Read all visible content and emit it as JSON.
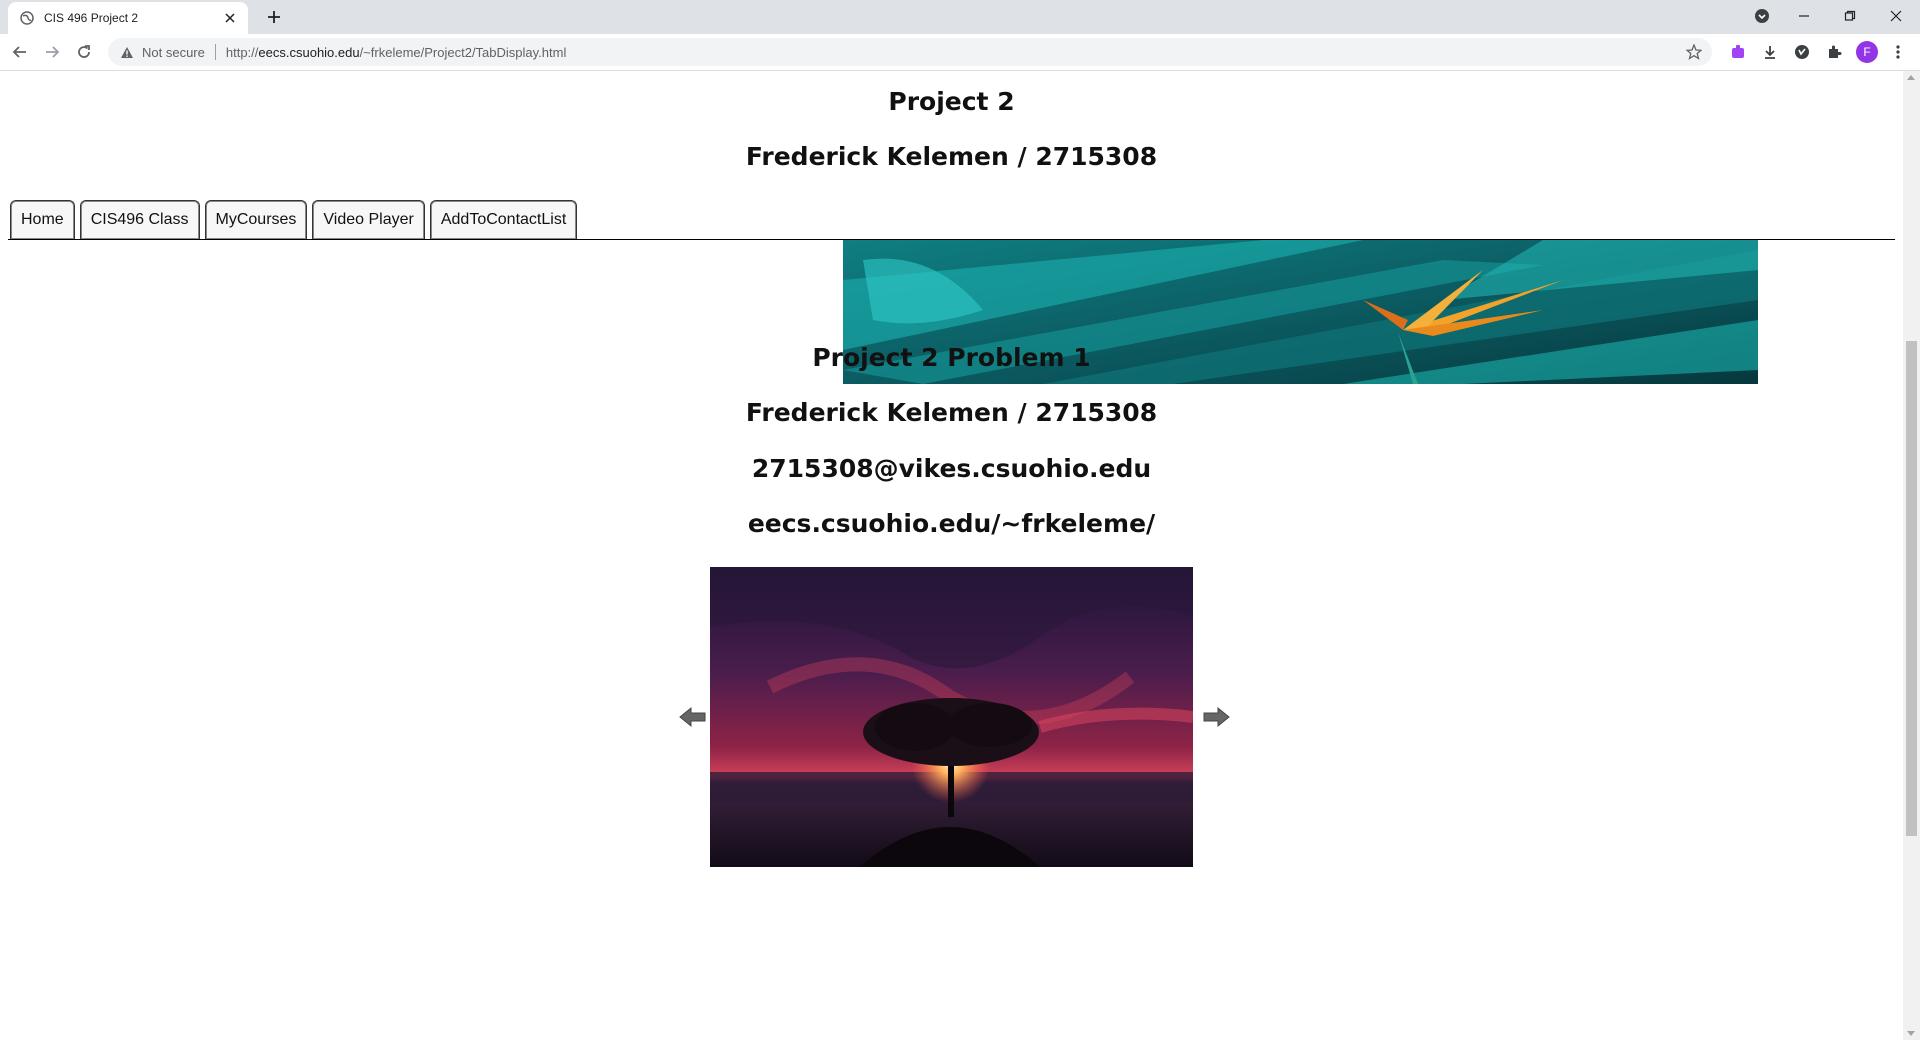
{
  "browser": {
    "tab_title": "CIS 496 Project 2",
    "security_label": "Not secure",
    "url_prefix": "http://",
    "url_host": "eecs.csuohio.edu",
    "url_path": "/~frkeleme/Project2/TabDisplay.html",
    "avatar_initial": "F"
  },
  "page": {
    "title": "Project 2",
    "author_line": "Frederick Kelemen / 2715308",
    "tabs": [
      {
        "label": "Home"
      },
      {
        "label": "CIS496 Class"
      },
      {
        "label": "MyCourses"
      },
      {
        "label": "Video Player"
      },
      {
        "label": "AddToContactList"
      }
    ],
    "problem_title": "Project 2 Problem 1",
    "problem_author": "Frederick Kelemen / 2715308",
    "email": "2715308@vikes.csuohio.edu",
    "website": "eecs.csuohio.edu/~frkeleme/"
  },
  "colors": {
    "chrome_bg": "#dee1e6",
    "omnibox_bg": "#f1f3f4",
    "avatar": "#9334e6"
  }
}
